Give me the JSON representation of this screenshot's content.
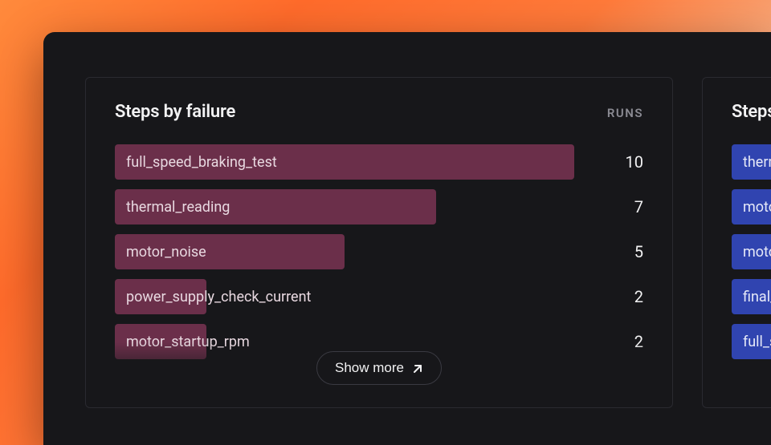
{
  "panels": {
    "left": {
      "title": "Steps by failure",
      "runs_label": "RUNS",
      "max_value": 10,
      "rows": [
        {
          "label": "full_speed_braking_test",
          "value": 10
        },
        {
          "label": "thermal_reading",
          "value": 7
        },
        {
          "label": "motor_noise",
          "value": 5
        },
        {
          "label": "power_supply_check_current",
          "value": 2
        },
        {
          "label": "motor_startup_rpm",
          "value": 2
        }
      ],
      "show_more": "Show more"
    },
    "right": {
      "title": "Steps by",
      "rows": [
        {
          "label": "thermal_"
        },
        {
          "label": "motor_st"
        },
        {
          "label": "motor_n"
        },
        {
          "label": "final_rpr"
        },
        {
          "label": "full_spee"
        }
      ]
    }
  },
  "colors": {
    "bar_failure": "#6b2f4a",
    "bar_other": "#3044b0"
  }
}
